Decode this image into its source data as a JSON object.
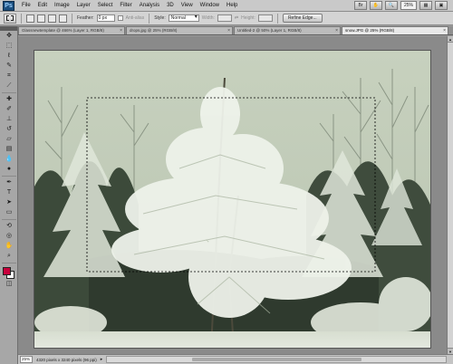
{
  "app": {
    "logo": "Ps"
  },
  "menu": {
    "items": [
      "File",
      "Edit",
      "Image",
      "Layer",
      "Select",
      "Filter",
      "Analysis",
      "3D",
      "View",
      "Window",
      "Help"
    ],
    "zoom": "25%"
  },
  "options": {
    "feather_label": "Feather:",
    "feather_value": "0 px",
    "antialias_label": "Anti-alias",
    "style_label": "Style:",
    "style_value": "Normal",
    "width_label": "Width:",
    "height_label": "Height:",
    "refine_edge_label": "Refine Edge..."
  },
  "tabs": [
    {
      "label": "Glassnewtemplate @ 466% (Layer 1, RGB/8)"
    },
    {
      "label": "drops.jpg @ 25% (RGB/8)"
    },
    {
      "label": "Untitled-2 @ 50% (Layer 1, RGB/8)"
    },
    {
      "label": "snow.JPG @ 25% (RGB/8)"
    }
  ],
  "status": {
    "zoom": "25%",
    "info": "4320 pixels x 3240 pixels (96 ppi)"
  },
  "colors": {
    "foreground": "#c8003c",
    "background": "#ffffff",
    "accent": "#1c4f7f"
  },
  "icons": {
    "tools": [
      "move-tool-icon",
      "marquee-tool-icon",
      "lasso-tool-icon",
      "quick-selection-icon",
      "crop-tool-icon",
      "eyedropper-icon",
      "healing-brush-icon",
      "brush-icon",
      "clone-stamp-icon",
      "history-brush-icon",
      "eraser-icon",
      "gradient-icon",
      "blur-icon",
      "dodge-icon",
      "pen-icon",
      "type-tool-icon",
      "path-selection-icon",
      "shape-tool-icon",
      "3d-rotate-icon",
      "3d-orbit-icon",
      "hand-tool-icon",
      "zoom-tool-icon"
    ]
  }
}
